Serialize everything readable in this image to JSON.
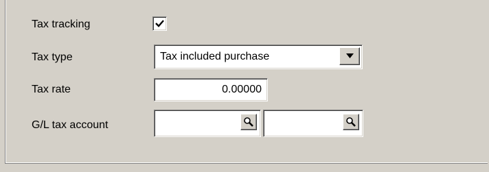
{
  "tax_tracking": {
    "label": "Tax tracking",
    "checked": true
  },
  "tax_type": {
    "label": "Tax type",
    "selected": "Tax included purchase"
  },
  "tax_rate": {
    "label": "Tax rate",
    "value": "0.00000"
  },
  "gl_tax_account": {
    "label": "G/L tax account",
    "value_1": "",
    "value_2": ""
  },
  "icons": {
    "checkbox": "check-icon",
    "dropdown": "dropdown-arrow-icon",
    "lookup": "magnifier-icon"
  },
  "colors": {
    "face": "#d4d0c8",
    "field": "#ffffff",
    "shadow": "#808080"
  }
}
